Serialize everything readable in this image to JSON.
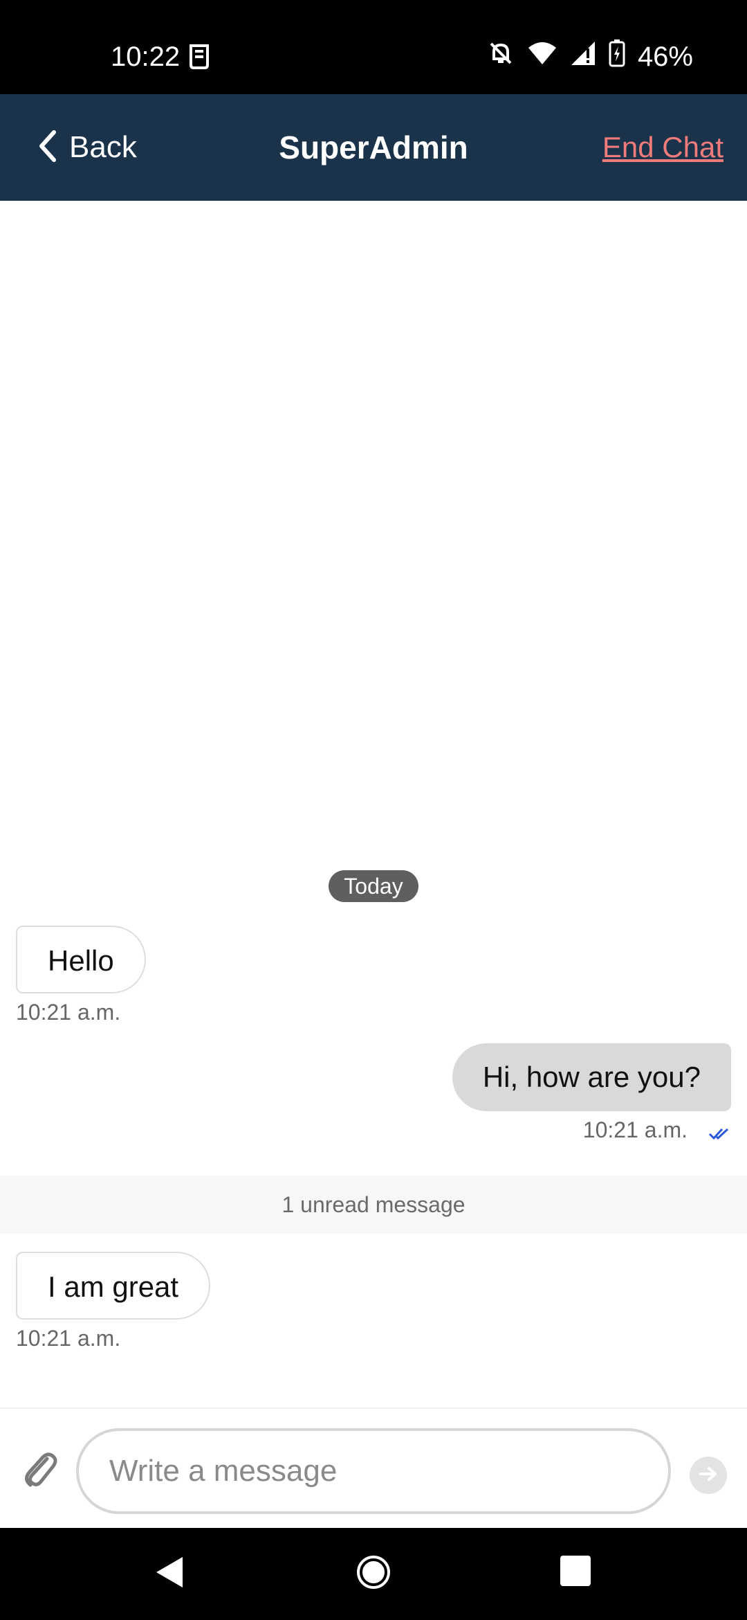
{
  "status_bar": {
    "time": "10:22",
    "battery": "46%",
    "left_icons": [
      "sim-icon"
    ],
    "right_icons": [
      "notifications-off-icon",
      "wifi-icon",
      "signal-icon",
      "battery-charging-icon"
    ]
  },
  "header": {
    "back_label": "Back",
    "title": "SuperAdmin",
    "end_chat_label": "End Chat",
    "background_color": "#1a334a",
    "end_chat_color": "#f07b7b"
  },
  "chat": {
    "date_label": "Today",
    "messages": [
      {
        "direction": "incoming",
        "text": "Hello",
        "time": "10:21 a.m."
      },
      {
        "direction": "outgoing",
        "text": "Hi, how are you?",
        "time": "10:21 a.m.",
        "read": true
      },
      {
        "direction": "incoming",
        "text": "I am great",
        "time": "10:21 a.m."
      }
    ],
    "unread_label": "1 unread message"
  },
  "composer": {
    "placeholder": "Write a message",
    "value": ""
  },
  "nav": {
    "buttons": [
      "back-nav",
      "home-nav",
      "recents-nav"
    ]
  }
}
